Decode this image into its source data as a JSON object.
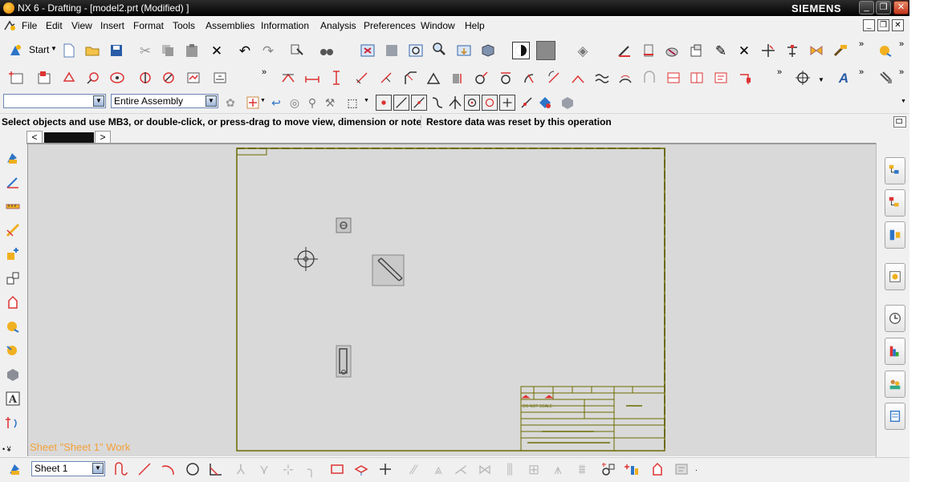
{
  "window": {
    "title": "NX 6 - Drafting - [model2.prt (Modified) ]",
    "brand": "SIEMENS",
    "controls": [
      "minimize-icon",
      "restore-icon",
      "close-icon"
    ]
  },
  "menu": {
    "items": [
      "File",
      "Edit",
      "View",
      "Insert",
      "Format",
      "Tools",
      "Assemblies",
      "Information",
      "Analysis",
      "Preferences",
      "Window",
      "Help"
    ]
  },
  "toolbar1": {
    "start_label": "Start"
  },
  "selection_bar": {
    "filter_value": "",
    "scope_value": "Entire Assembly"
  },
  "status": {
    "cue": "Select objects and use MB3, or double-click, or press-drag to move view, dimension or note",
    "message": "Restore data was reset by this operation"
  },
  "drawing": {
    "work_label": "Sheet \"Sheet 1\" Work",
    "title_block": {
      "scale_note": "DO NOT SCALE"
    }
  },
  "bottom": {
    "sheet_value": "Sheet 1"
  },
  "colors": {
    "border_line": "#6b6a00",
    "work_label": "#f2a13a",
    "graphics_bg": "#d9d9d9"
  }
}
